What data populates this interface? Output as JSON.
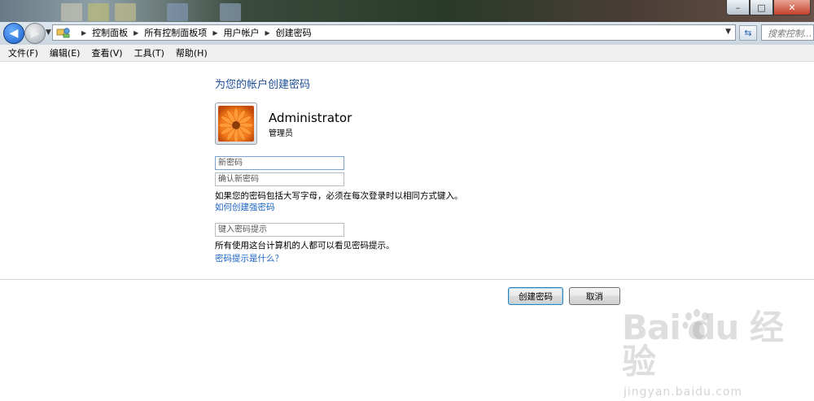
{
  "window": {
    "buttons": {
      "minimize": "–",
      "maximize": "□",
      "close": "✕"
    }
  },
  "address": {
    "icon": "control-panel-icon",
    "breadcrumbs": [
      "控制面板",
      "所有控制面板项",
      "用户帐户",
      "创建密码"
    ],
    "search_placeholder": "搜索控制..."
  },
  "menu": [
    "文件(F)",
    "编辑(E)",
    "查看(V)",
    "工具(T)",
    "帮助(H)"
  ],
  "page": {
    "heading": "为您的帐户创建密码",
    "user": {
      "name": "Administrator",
      "role": "管理员"
    },
    "fields": {
      "new_password": "新密码",
      "confirm_password": "确认新密码",
      "hint": "键入密码提示"
    },
    "case_note": "如果您的密码包括大写字母，必须在每次登录时以相同方式键入。",
    "strong_link": "如何创建强密码",
    "hint_note": "所有使用这台计算机的人都可以看见密码提示。",
    "hint_link": "密码提示是什么？"
  },
  "buttons": {
    "create": "创建密码",
    "cancel": "取消"
  },
  "watermark": {
    "main": "Bai  du 经验",
    "sub": "jingyan.baidu.com"
  },
  "colors": {
    "heading": "#1e4d9a",
    "link": "#1a63c4",
    "accent": "#3c7fb1"
  }
}
